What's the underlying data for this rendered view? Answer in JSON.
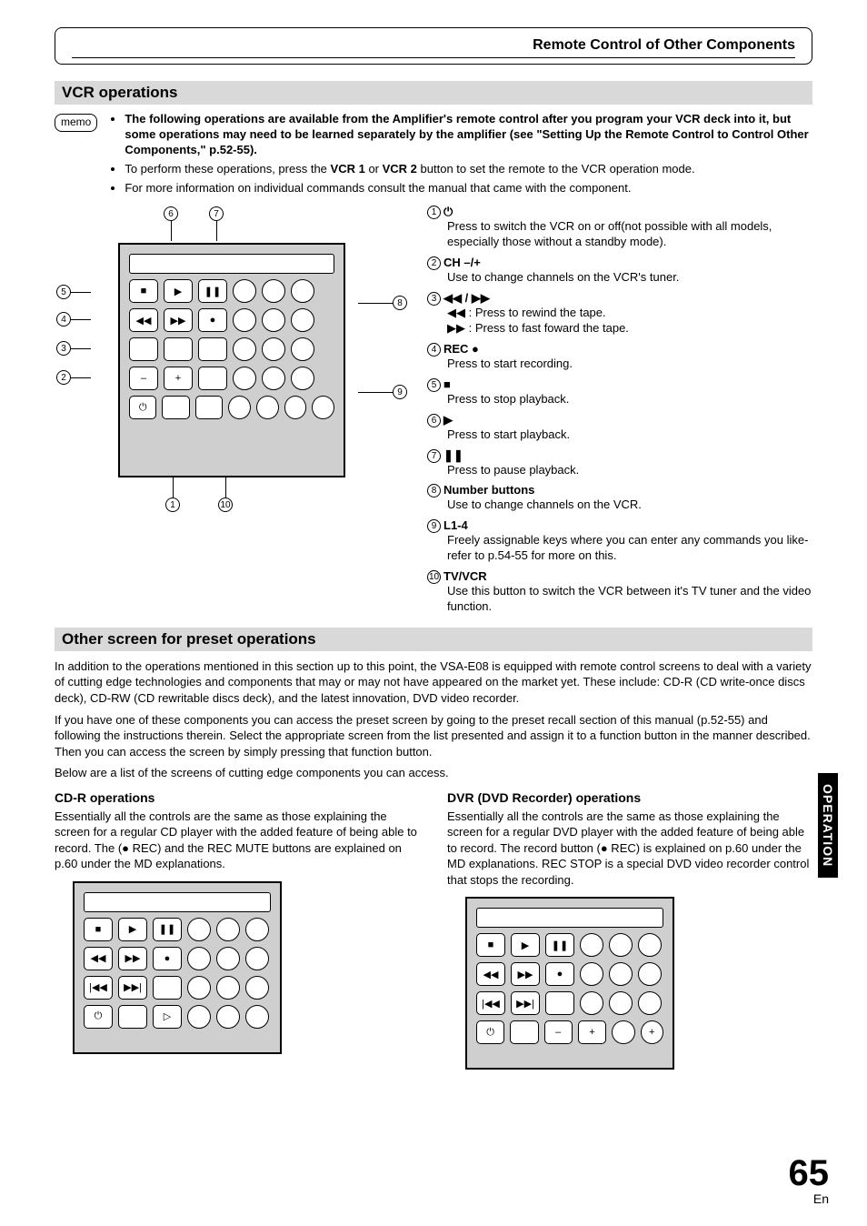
{
  "header": {
    "title": "Remote Control of Other Components"
  },
  "section1": {
    "title": "VCR operations",
    "memo_label": "memo",
    "bullets": [
      "The following operations are available from the Amplifier's remote control after you program your VCR deck into it, but some operations may need to be learned separately by the amplifier (see \"Setting Up the Remote Control to Control Other Components,\" p.52-55).",
      "To perform these operations, press the VCR 1 or VCR 2 button to set the remote to the VCR operation mode.",
      "For more information on individual commands consult the manual that came with the component."
    ],
    "bullet1_pre": "To perform these operations, press the ",
    "bullet1_b1": "VCR 1",
    "bullet1_mid": " or ",
    "bullet1_b2": "VCR 2",
    "bullet1_post": " button to set the remote to the VCR operation mode."
  },
  "callouts": [
    {
      "n": "1",
      "label": "⏻",
      "desc": "Press to switch the VCR on or off(not possible with all models, especially those without a standby mode)."
    },
    {
      "n": "2",
      "label": "CH –/+",
      "desc": "Use to change channels on the VCR's tuner."
    },
    {
      "n": "3",
      "label": "◀◀ / ▶▶",
      "desc": "◀◀ : Press to rewind the tape.\n▶▶ : Press to fast foward the tape."
    },
    {
      "n": "4",
      "label": "REC ●",
      "desc": "Press to start recording."
    },
    {
      "n": "5",
      "label": "■",
      "desc": "Press to stop playback."
    },
    {
      "n": "6",
      "label": "▶",
      "desc": "Press to start playback."
    },
    {
      "n": "7",
      "label": "❚❚",
      "desc": "Press to pause playback."
    },
    {
      "n": "8",
      "label": "Number buttons",
      "desc": "Use to change channels on the VCR."
    },
    {
      "n": "9",
      "label": "L1-4",
      "desc": "Freely assignable keys where you can enter any commands you like-refer to p.54-55 for more on this."
    },
    {
      "n": "10",
      "label": "TV/VCR",
      "desc": "Use this button to switch the VCR between it's TV tuner  and the video function."
    }
  ],
  "section2": {
    "title": "Other screen for preset operations",
    "para1": "In addition to the operations mentioned in this section up to this point, the VSA-E08 is equipped with remote control screens to deal with a variety of cutting edge technologies and components that may or may not have appeared on the  market yet. These include: CD-R (CD write-once discs deck), CD-RW (CD rewritable discs deck), and the latest innovation, DVD video recorder.",
    "para2": "If you have one of these components you can access the preset screen by going to the preset recall section of this manual (p.52-55) and following the instructions therein. Select the appropriate screen from the list presented and assign it to a function button in the manner described. Then you can access the screen by simply pressing that function button.",
    "para3": "Below are a list of the screens of cutting edge components you can access."
  },
  "cdr": {
    "title": "CD-R operations",
    "body": "Essentially all the controls are the same as those explaining the screen for a regular CD player with the added feature of being able to record. The (● REC) and the REC MUTE buttons are explained on p.60 under the MD explanations."
  },
  "dvr": {
    "title": "DVR (DVD Recorder) operations",
    "body": "Essentially all the controls are the same as those explaining the screen for a regular DVD player with the added feature of being able to record. The record button (● REC) is explained on p.60 under the MD explanations. REC STOP is a special DVD video recorder control that stops the recording."
  },
  "side_tab": "OPERATION",
  "page": {
    "num": "65",
    "lang": "En"
  },
  "icons": {
    "stop": "■",
    "play": "▶",
    "pause": "❚❚",
    "rew": "◀◀",
    "ff": "▶▶",
    "rec": "●",
    "prev": "|◀◀",
    "next": "▶▶|",
    "power": "⏻",
    "right_arrow": "▷",
    "minus": "–",
    "plus": "+"
  }
}
